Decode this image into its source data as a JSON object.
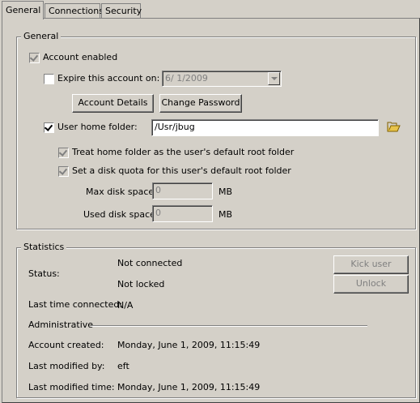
{
  "tabs": [
    {
      "label": "General",
      "active": true
    },
    {
      "label": "Connections",
      "active": false
    },
    {
      "label": "Security",
      "active": false
    }
  ],
  "general": {
    "title": "General",
    "account_enabled": {
      "label": "Account enabled",
      "checked": true,
      "enabled": false
    },
    "expire": {
      "label": "Expire this account on:",
      "checked": false,
      "date_value": "6/ 1/2009"
    },
    "account_details_button": "Account Details",
    "change_password_button": "Change Password",
    "home_folder": {
      "label": "User home folder:",
      "checked": true,
      "value": "/Usr/jbug",
      "browse_icon": "folder-open-icon"
    },
    "treat_home_root": {
      "label": "Treat home folder as the user's default root folder",
      "checked": true
    },
    "disk_quota": {
      "label": "Set a disk quota for this user's default root folder",
      "checked": true
    },
    "max_disk": {
      "label": "Max disk space:",
      "value": "0",
      "unit": "MB"
    },
    "used_disk": {
      "label": "Used disk space:",
      "value": "0",
      "unit": "MB"
    }
  },
  "statistics": {
    "title": "Statistics",
    "status_label": "Status:",
    "status_connected": "Not connected",
    "status_locked": "Not locked",
    "kick_user_button": "Kick user",
    "unlock_button": "Unlock",
    "last_connected_label": "Last time connected:",
    "last_connected_value": "N/A",
    "administrative_label": "Administrative",
    "account_created_label": "Account created:",
    "account_created_value": "Monday, June 1, 2009, 11:15:49",
    "last_modified_by_label": "Last modified by:",
    "last_modified_by_value": "eft",
    "last_modified_time_label": "Last modified time:",
    "last_modified_time_value": "Monday, June 1, 2009, 11:15:49"
  },
  "colors": {
    "face": "#d4d0c8",
    "shadow": "#808080",
    "highlight": "#ffffff",
    "folder": "#e8c34a"
  }
}
